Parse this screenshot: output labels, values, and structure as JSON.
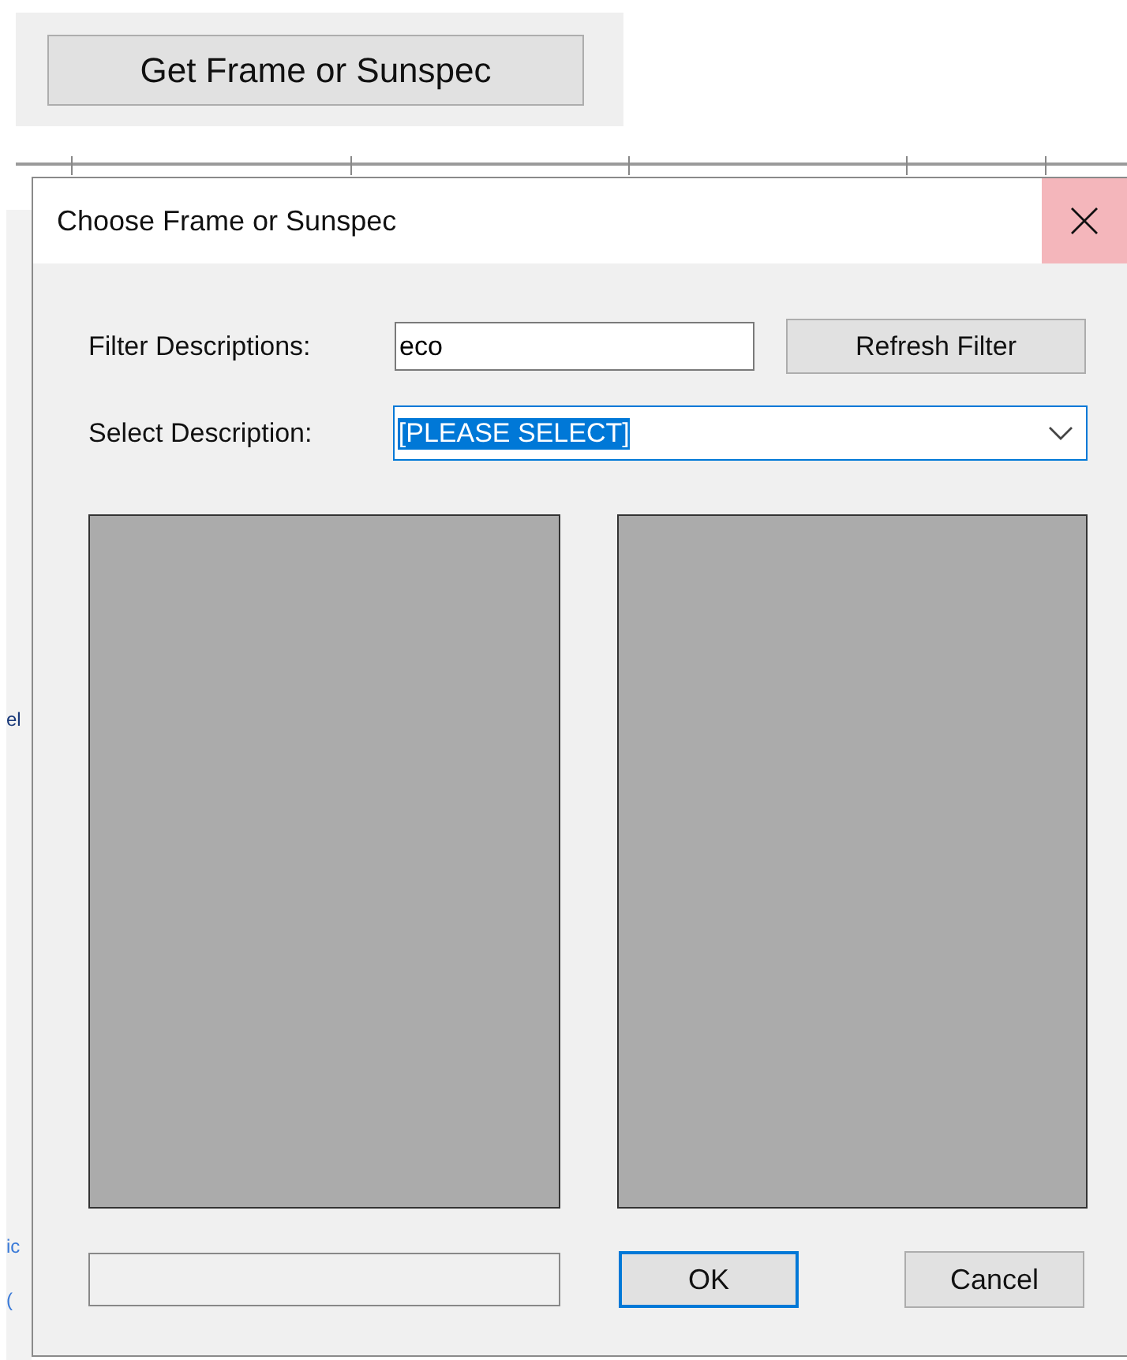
{
  "launcher_button": {
    "label": "Get Frame or Sunspec"
  },
  "background_window": {
    "fragments": [
      {
        "text": "el"
      },
      {
        "text": "ic"
      },
      {
        "text": "("
      }
    ]
  },
  "dialog": {
    "title": "Choose Frame or Sunspec",
    "close_hovered": true,
    "filter": {
      "label": "Filter Descriptions:",
      "value": "eco"
    },
    "refresh_button": {
      "label": "Refresh Filter"
    },
    "select": {
      "label": "Select Description:",
      "value": "[PLEASE SELECT]",
      "text_selected": true
    },
    "buttons": [
      {
        "label": "OK",
        "default": true
      },
      {
        "label": "Cancel",
        "default": false
      }
    ]
  }
}
